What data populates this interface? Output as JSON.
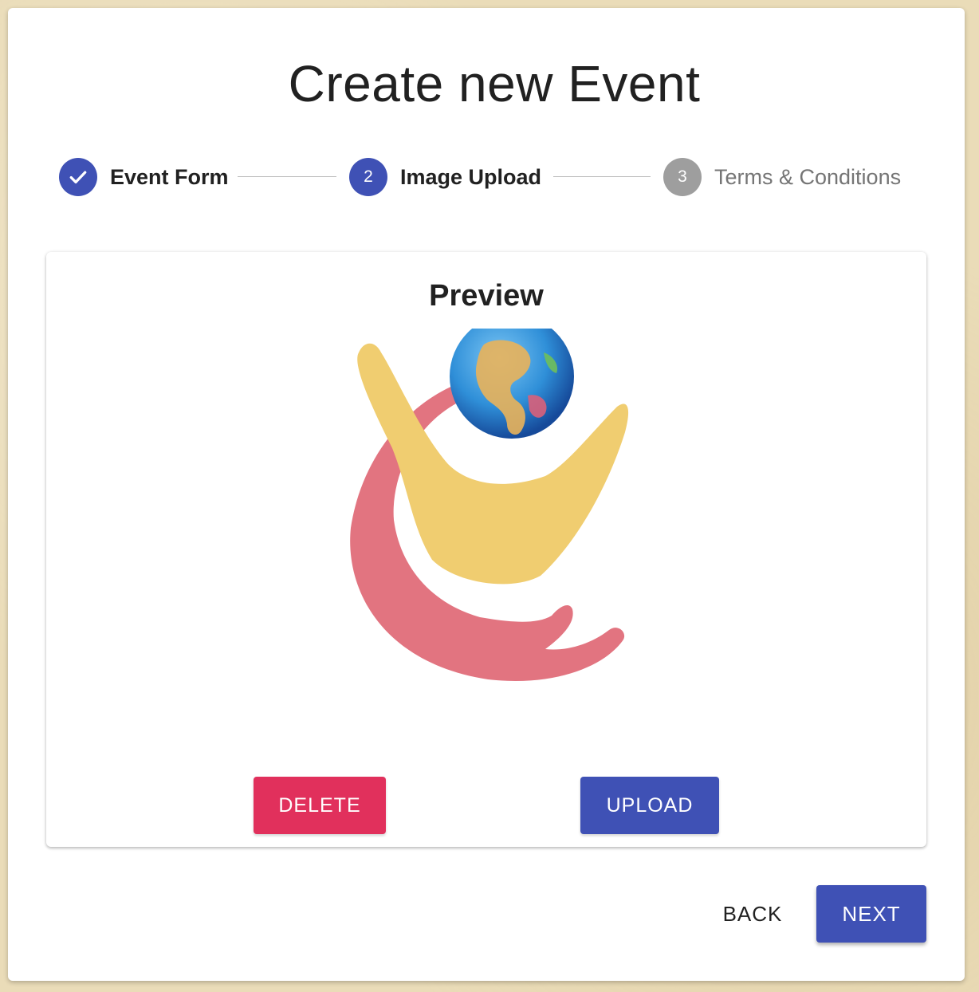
{
  "page": {
    "title": "Create new Event"
  },
  "stepper": {
    "steps": [
      {
        "number": "",
        "label": "Event Form",
        "state": "completed",
        "icon": "check-icon"
      },
      {
        "number": "2",
        "label": "Image Upload",
        "state": "active"
      },
      {
        "number": "3",
        "label": "Terms & Conditions",
        "state": "pending"
      }
    ]
  },
  "preview": {
    "title": "Preview",
    "image_icon": "globe-in-hands-logo-image",
    "delete_label": "DELETE",
    "upload_label": "UPLOAD"
  },
  "footer": {
    "back_label": "BACK",
    "next_label": "NEXT"
  },
  "colors": {
    "primary": "#3f51b5",
    "delete": "#e1305c",
    "pending_step": "#9e9e9e",
    "logo_yellow": "#f0cd70",
    "logo_pink": "#e27480",
    "globe_blue": "#2f8fd8"
  }
}
